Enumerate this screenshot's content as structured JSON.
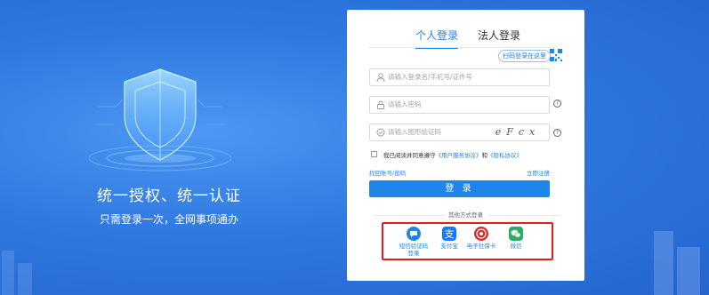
{
  "hero": {
    "title": "统一授权、统一认证",
    "subtitle": "只需登录一次，全网事项通办"
  },
  "tabs": [
    {
      "label": "个人登录",
      "active": true
    },
    {
      "label": "法人登录",
      "active": false
    }
  ],
  "qr_login": {
    "label": "扫码登录在这里",
    "icon": "qr-code-icon"
  },
  "fields": {
    "username_placeholder": "请输入登录名/手机号/证件号",
    "password_placeholder": "请输入密码",
    "captcha_placeholder": "请输入图形验证码",
    "captcha_text": "eFcx"
  },
  "agreement": {
    "prefix": "我已阅读并同意遵守",
    "service_link": "《用户服务协议》",
    "conjunction": "和",
    "privacy_link": "《隐私协议》"
  },
  "links": {
    "recover": "找回账号/密码",
    "register": "立即注册"
  },
  "login_button": "登 录",
  "other_methods": {
    "title": "其他方式登录",
    "items": [
      {
        "label": "短信验证码\n登录",
        "icon": "sms-icon",
        "color": "#1e86ea"
      },
      {
        "label": "支付宝",
        "icon": "alipay-icon",
        "color": "#1677ff"
      },
      {
        "label": "电子社保卡",
        "icon": "social-security-card-icon",
        "color": "#d82a2a"
      },
      {
        "label": "微信",
        "icon": "wechat-icon",
        "color": "#2aae67"
      }
    ]
  },
  "colors": {
    "accent": "#1e86ea",
    "background": "#2a6fd8",
    "highlight_border": "#e01e1e"
  }
}
